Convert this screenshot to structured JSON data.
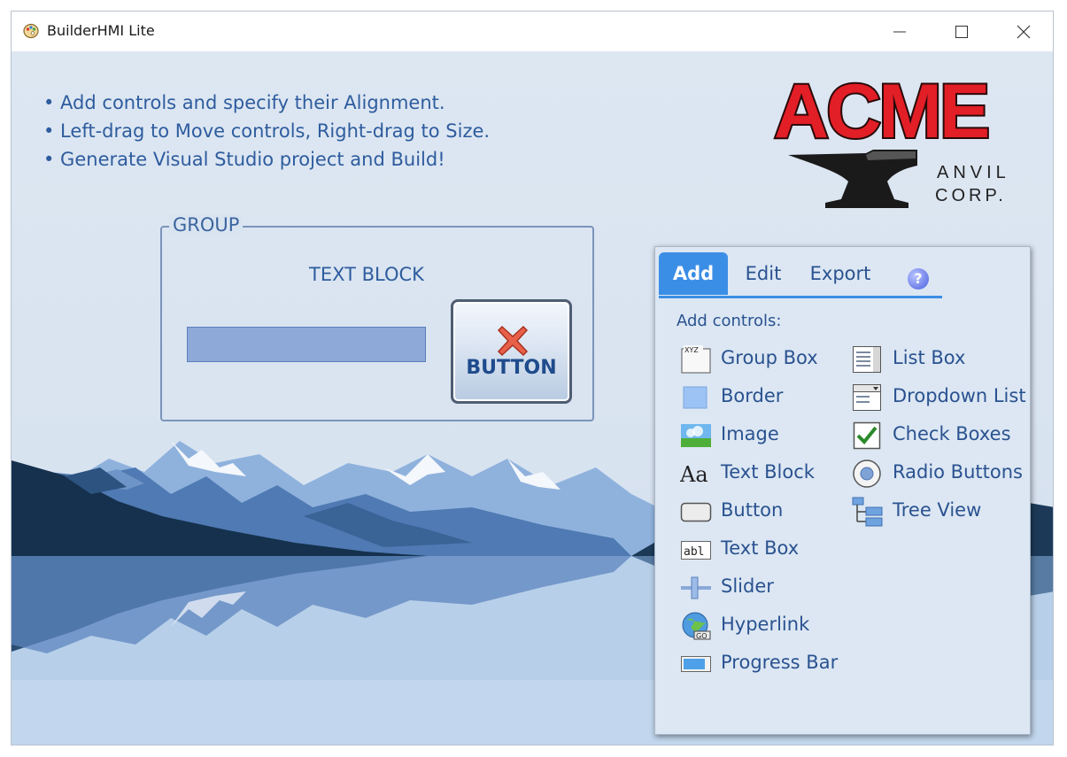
{
  "window": {
    "title": "BuilderHMI Lite",
    "minimize_icon": "minimize-icon",
    "maximize_icon": "maximize-icon",
    "close_icon": "close-icon"
  },
  "instructions": [
    "• Add controls and specify their Alignment.",
    "• Left-drag to Move controls, Right-drag to Size.",
    "• Generate Visual Studio project and Build!"
  ],
  "logo": {
    "name": "ACME",
    "line1": "ANVIL",
    "line2": "CORP."
  },
  "canvas": {
    "group_label": "GROUP",
    "text_block": "TEXT BLOCK",
    "button_label": "BUTTON"
  },
  "panel": {
    "tabs": [
      {
        "label": "Add",
        "active": true
      },
      {
        "label": "Edit",
        "active": false
      },
      {
        "label": "Export",
        "active": false
      }
    ],
    "help_label": "?",
    "heading": "Add controls:",
    "left_controls": [
      {
        "label": "Group Box",
        "icon": "group-box-icon"
      },
      {
        "label": "Border",
        "icon": "border-icon"
      },
      {
        "label": "Image",
        "icon": "image-icon"
      },
      {
        "label": "Text Block",
        "icon": "text-block-icon"
      },
      {
        "label": "Button",
        "icon": "button-icon"
      },
      {
        "label": "Text Box",
        "icon": "text-box-icon"
      },
      {
        "label": "Slider",
        "icon": "slider-icon"
      },
      {
        "label": "Hyperlink",
        "icon": "hyperlink-icon"
      },
      {
        "label": "Progress Bar",
        "icon": "progress-bar-icon"
      }
    ],
    "right_controls": [
      {
        "label": "List Box",
        "icon": "list-box-icon"
      },
      {
        "label": "Dropdown List",
        "icon": "dropdown-list-icon"
      },
      {
        "label": "Check Boxes",
        "icon": "check-boxes-icon"
      },
      {
        "label": "Radio Buttons",
        "icon": "radio-buttons-icon"
      },
      {
        "label": "Tree View",
        "icon": "tree-view-icon"
      }
    ]
  },
  "colors": {
    "accent": "#3b8ee6",
    "text": "#2a5290",
    "logo_red": "#e21e26"
  }
}
